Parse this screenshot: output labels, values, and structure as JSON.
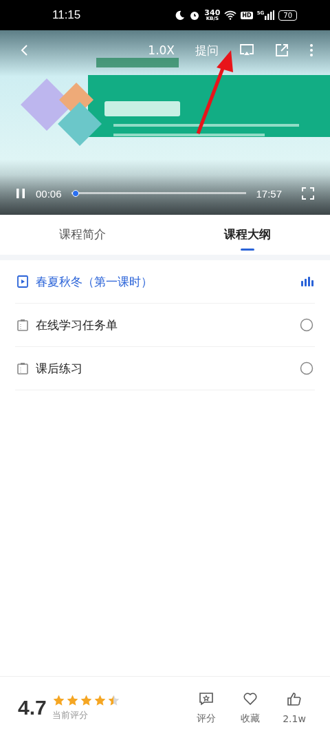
{
  "status_bar": {
    "time": "11:15",
    "speed_value": "340",
    "speed_unit": "KB/S",
    "hd": "HD",
    "network": "5G",
    "battery": "70"
  },
  "player": {
    "speed": "1.0X",
    "ask": "提问",
    "playing": true,
    "elapsed": "00:06",
    "duration": "17:57",
    "level": 0.006
  },
  "tabs": [
    {
      "label": "课程简介",
      "selected": false
    },
    {
      "label": "课程大纲",
      "selected": true
    }
  ],
  "outline": [
    {
      "kind": "video",
      "title": "春夏秋冬（第一课时）",
      "selected": true
    },
    {
      "kind": "doc",
      "title": "在线学习任务单",
      "selected": false,
      "done": false
    },
    {
      "kind": "doc",
      "title": "课后练习",
      "selected": false,
      "done": false
    }
  ],
  "footer": {
    "score": "4.7",
    "stars": 4.5,
    "score_label": "当前评分",
    "actions": [
      {
        "kind": "rate",
        "label": "评分"
      },
      {
        "kind": "favorite",
        "label": "收藏"
      },
      {
        "kind": "like",
        "label": "2.1w"
      }
    ]
  }
}
